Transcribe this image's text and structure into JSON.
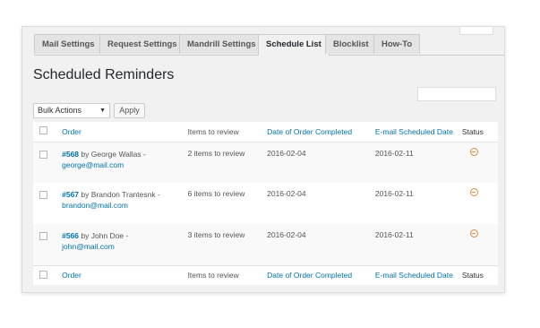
{
  "tabs": [
    {
      "label": "Mail Settings",
      "active": false
    },
    {
      "label": "Request Settings",
      "active": false
    },
    {
      "label": "Mandrill Settings",
      "active": false
    },
    {
      "label": "Schedule List",
      "active": true
    },
    {
      "label": "Blocklist",
      "active": false
    },
    {
      "label": "How-To",
      "active": false
    }
  ],
  "page": {
    "title": "Scheduled Reminders"
  },
  "bulk": {
    "selected": "Bulk Actions",
    "apply_label": "Apply"
  },
  "table": {
    "columns": [
      "Order",
      "Items to review",
      "Date of Order Completed",
      "E-mail Scheduled Date",
      "Status"
    ],
    "rows": [
      {
        "order_num": "#568",
        "order_by": "by George Wallas -",
        "email": "george@mail.com",
        "items": "2 items to review",
        "date_completed": "2016-02-04",
        "scheduled_date": "2016-02-11"
      },
      {
        "order_num": "#567",
        "order_by": "by Brandon Trantesnk -",
        "email": "brandon@mail.com",
        "items": "6 items to review",
        "date_completed": "2016-02-04",
        "scheduled_date": "2016-02-11"
      },
      {
        "order_num": "#566",
        "order_by": "by John Doe -",
        "email": "john@mail.com",
        "items": "3 items to review",
        "date_completed": "2016-02-04",
        "scheduled_date": "2016-02-11"
      }
    ]
  },
  "colors": {
    "accent": "#0073aa",
    "status": "#e08a3c"
  },
  "icons": {
    "status": "minus-circle-icon",
    "dropdown": "chevron-down-icon"
  }
}
